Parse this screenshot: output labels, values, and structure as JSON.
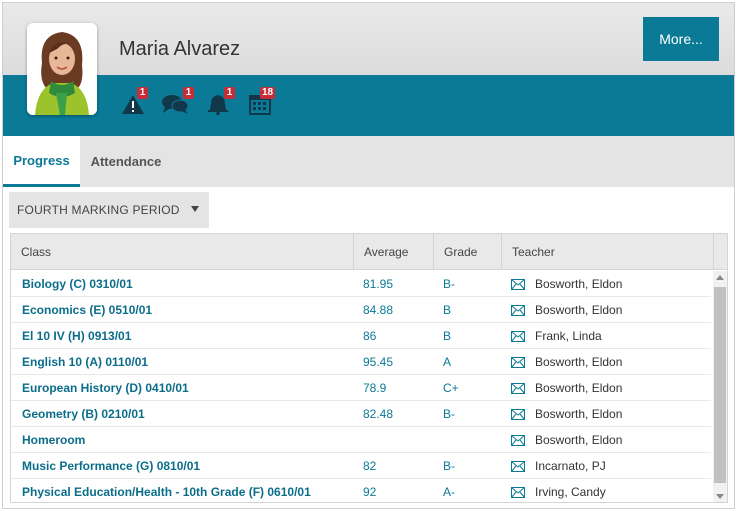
{
  "student": {
    "name": "Maria Alvarez"
  },
  "header": {
    "more_label": "More..."
  },
  "notifications": [
    {
      "icon": "alert-triangle-icon",
      "count": "1"
    },
    {
      "icon": "chat-bubbles-icon",
      "count": "1"
    },
    {
      "icon": "bell-icon",
      "count": "1"
    },
    {
      "icon": "calendar-icon",
      "count": "18"
    }
  ],
  "tabs": [
    {
      "label": "Progress",
      "active": true
    },
    {
      "label": "Attendance",
      "active": false
    }
  ],
  "period_selector": {
    "value": "FOURTH MARKING PERIOD"
  },
  "table": {
    "columns": [
      "Class",
      "Average",
      "Grade",
      "Teacher"
    ],
    "rows": [
      {
        "class": "Biology (C) 0310/01",
        "average": "81.95",
        "grade": "B-",
        "teacher": "Bosworth, Eldon"
      },
      {
        "class": "Economics (E) 0510/01",
        "average": "84.88",
        "grade": "B",
        "teacher": "Bosworth, Eldon"
      },
      {
        "class": "El 10 IV (H) 0913/01",
        "average": "86",
        "grade": "B",
        "teacher": "Frank, Linda"
      },
      {
        "class": "English 10 (A) 0110/01",
        "average": "95.45",
        "grade": "A",
        "teacher": "Bosworth, Eldon"
      },
      {
        "class": "European History (D) 0410/01",
        "average": "78.9",
        "grade": "C+",
        "teacher": "Bosworth, Eldon"
      },
      {
        "class": "Geometry (B) 0210/01",
        "average": "82.48",
        "grade": "B-",
        "teacher": "Bosworth, Eldon"
      },
      {
        "class": "Homeroom",
        "average": "",
        "grade": "",
        "teacher": "Bosworth, Eldon"
      },
      {
        "class": "Music Performance (G) 0810/01",
        "average": "82",
        "grade": "B-",
        "teacher": "Incarnato, PJ"
      },
      {
        "class": "Physical Education/Health - 10th Grade (F) 0610/01",
        "average": "92",
        "grade": "A-",
        "teacher": "Irving, Candy"
      }
    ]
  },
  "colors": {
    "accent": "#0b7a97",
    "badge": "#c62d36"
  }
}
